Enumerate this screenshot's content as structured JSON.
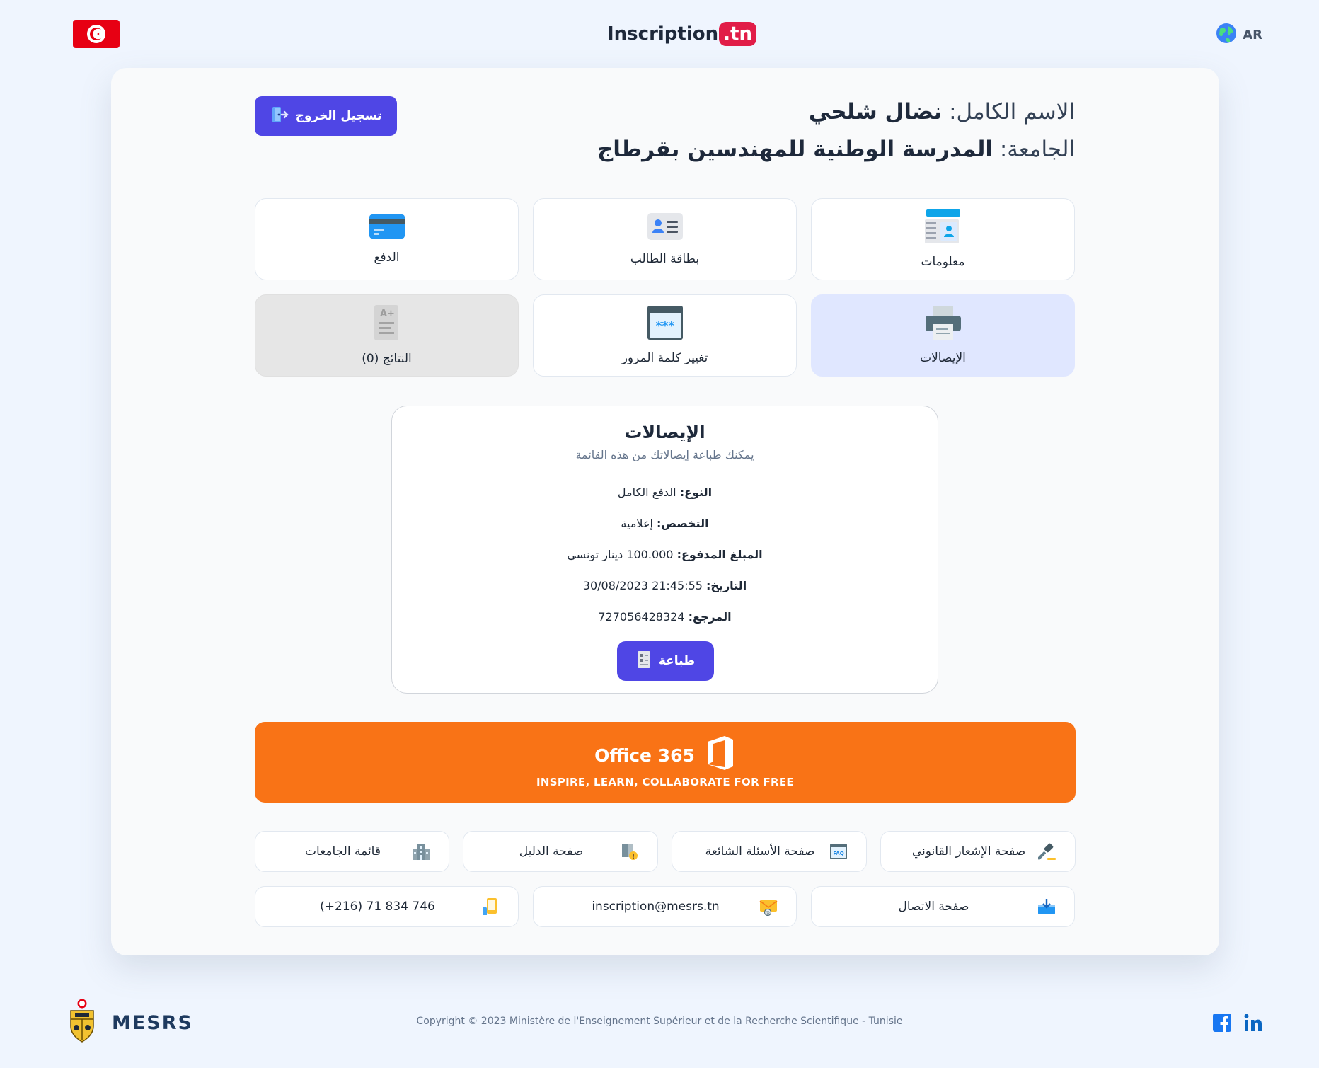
{
  "header": {
    "brand_main": "Inscription",
    "brand_suffix": ".tn",
    "language": "AR",
    "flag_icon": "tunisia-flag-icon"
  },
  "user": {
    "name_label": "الاسم الكامل:",
    "name_value": "نضال شلحي",
    "university_label": "الجامعة:",
    "university_value": "المدرسة الوطنية للمهندسين بقرطاج",
    "logout_label": "تسجيل الخروج"
  },
  "tiles": [
    {
      "label": "معلومات",
      "icon": "profile-info-icon",
      "state": "normal"
    },
    {
      "label": "بطاقة الطالب",
      "icon": "id-card-icon",
      "state": "normal"
    },
    {
      "label": "الدفع",
      "icon": "credit-card-icon",
      "state": "normal"
    },
    {
      "label": "الإيصالات",
      "icon": "printer-icon",
      "state": "active"
    },
    {
      "label": "تغيير كلمة المرور",
      "icon": "password-icon",
      "state": "normal"
    },
    {
      "label": "النتائج (0)",
      "icon": "grades-icon",
      "state": "disabled"
    }
  ],
  "receipt": {
    "title": "الإيصالات",
    "subtitle": "يمكنك طباعة إيصالاتك من هذه القائمة",
    "type_label": "النوع:",
    "type_value": "الدفع الكامل",
    "specialty_label": "التخصص:",
    "specialty_value": "إعلامية",
    "amount_label": "المبلغ المدفوع:",
    "amount_value": "100.000 دينار تونسي",
    "date_label": "التاريخ:",
    "date_value": "30/08/2023 21:45:55",
    "ref_label": "المرجع:",
    "ref_value": "727056428324",
    "print_label": "طباعة"
  },
  "office": {
    "title": "Office 365",
    "subtitle": "INSPIRE, LEARN, COLLABORATE FOR FREE"
  },
  "links": [
    {
      "label": "صفحة الإشعار القانوني",
      "icon": "gavel-icon"
    },
    {
      "label": "صفحة الأسئلة الشائعة",
      "icon": "faq-icon"
    },
    {
      "label": "صفحة الدليل",
      "icon": "guide-book-icon"
    },
    {
      "label": "قائمة الجامعات",
      "icon": "university-building-icon"
    }
  ],
  "contacts": [
    {
      "label": "صفحة الاتصال",
      "icon": "inbox-icon"
    },
    {
      "label": "inscription@mesrs.tn",
      "icon": "email-icon"
    },
    {
      "label": "(+216) 71 834 746",
      "icon": "phone-icon"
    }
  ],
  "footer": {
    "org": "MESRS",
    "copyright": "Copyright © 2023 Ministère de l'Enseignement Supérieur et de la Recherche Scientifique - Tunisie"
  },
  "colors": {
    "primary": "#4f46e5",
    "office": "#f97316",
    "background": "#eff5fe",
    "brand_accent": "#e11d48"
  }
}
